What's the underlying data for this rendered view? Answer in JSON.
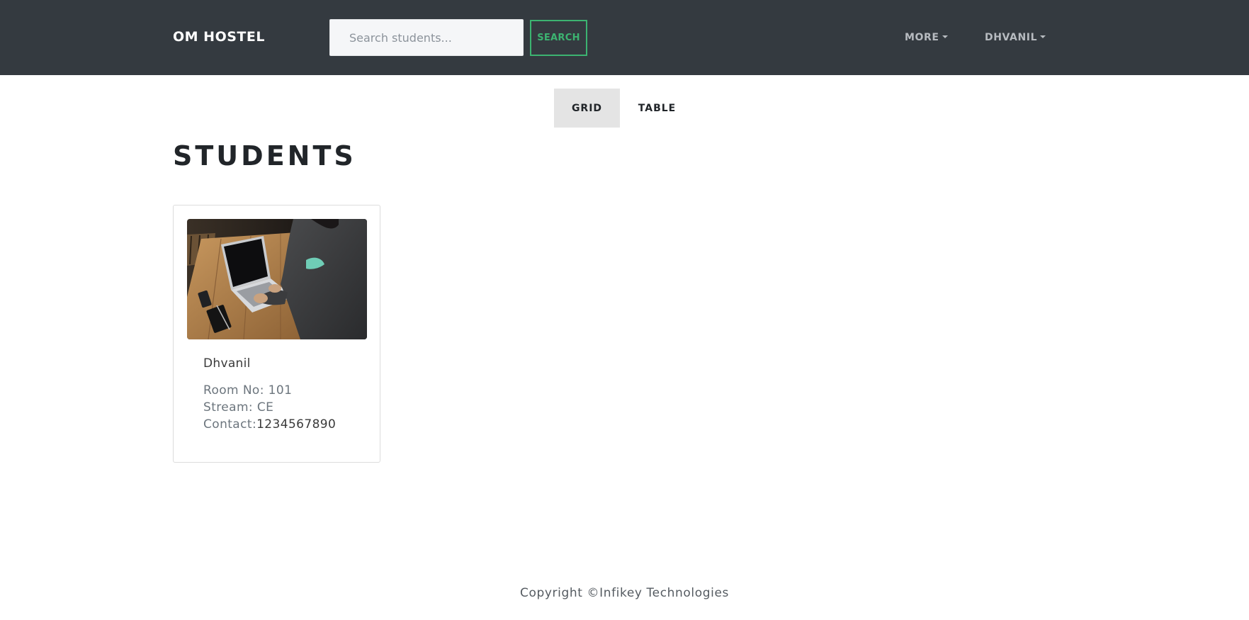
{
  "navbar": {
    "brand": "OM HOSTEL",
    "search_placeholder": "Search students...",
    "search_label": "SEARCH",
    "more_label": "MORE",
    "user_label": "DHVANIL"
  },
  "view_toggle": {
    "grid_label": "GRID",
    "table_label": "TABLE",
    "active": "GRID"
  },
  "page": {
    "title": "STUDENTS"
  },
  "students": [
    {
      "name": "Dhvanil",
      "room_label": "Room No: 101",
      "stream_label": "Stream: CE",
      "contact_prefix": "Contact:",
      "contact_value": "1234567890",
      "image": "photo-laptop"
    }
  ],
  "footer": {
    "text": "Copyright ©Infikey Technologies"
  },
  "colors": {
    "navbar_bg": "#343a40",
    "accent_green": "#3cb371",
    "toggle_active_bg": "#e4e4e4"
  }
}
